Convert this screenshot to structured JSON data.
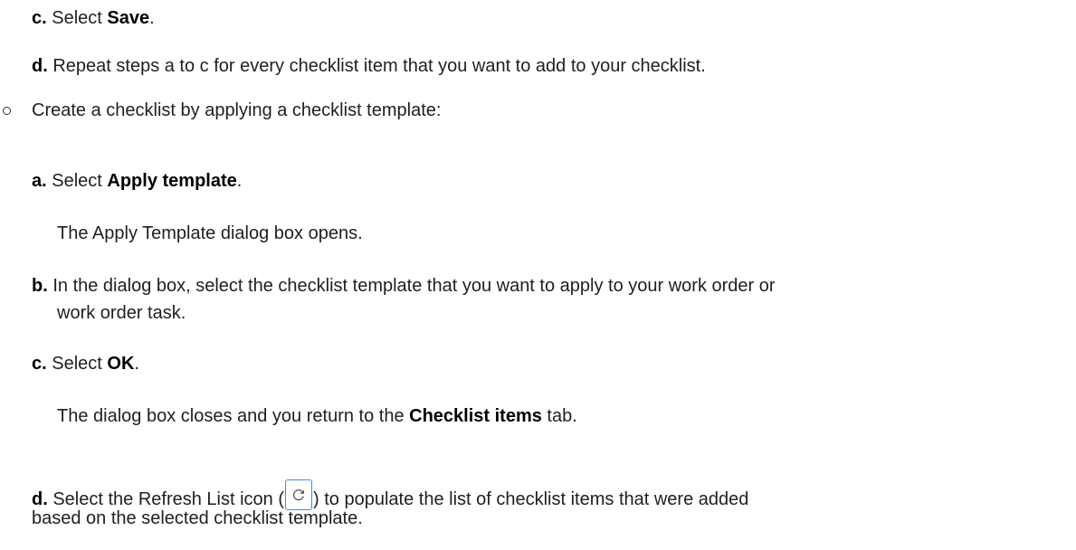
{
  "steps_top": {
    "c": {
      "marker": "c.",
      "pre": " Select ",
      "bold": "Save",
      "post": "."
    },
    "d": {
      "marker": "d.",
      "text": " Repeat steps a to c for every checklist item that you want to add to your checklist."
    }
  },
  "bullet": {
    "text": "Create a checklist by applying a checklist template:"
  },
  "template_steps": {
    "a": {
      "marker": "a.",
      "pre": " Select ",
      "bold": "Apply template",
      "post": ".",
      "note": "The Apply Template dialog box opens."
    },
    "b": {
      "marker": "b.",
      "line1": " In the dialog box, select the checklist template that you want to apply to your work order or",
      "line2": "work order task."
    },
    "c": {
      "marker": "c.",
      "pre": " Select ",
      "bold": "OK",
      "post": ".",
      "note_pre": "The dialog box closes and you return to the ",
      "note_bold": "Checklist items",
      "note_post": " tab."
    },
    "d": {
      "marker": "d.",
      "pre": " Select the Refresh List icon (",
      "post": ") to populate the list of checklist items that were added",
      "line2": "based on the selected checklist template."
    }
  },
  "icons": {
    "bullet": "hollow-circle-bullet",
    "refresh": "refresh-icon",
    "accent_color": "#3a8ee6"
  }
}
